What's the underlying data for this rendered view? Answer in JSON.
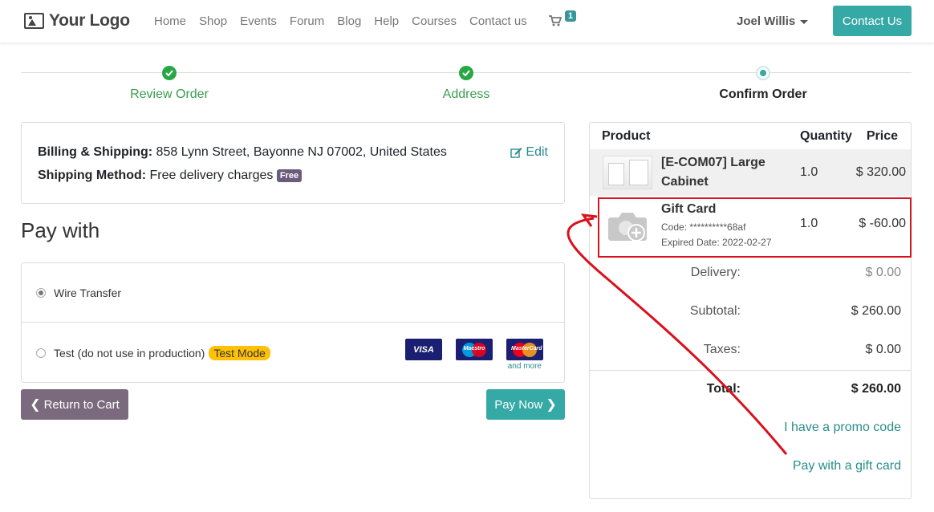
{
  "navbar": {
    "logo_text": "Your Logo",
    "links": [
      "Home",
      "Shop",
      "Events",
      "Forum",
      "Blog",
      "Help",
      "Courses",
      "Contact us"
    ],
    "cart_count": "1",
    "user_name": "Joel Willis",
    "contact_button": "Contact Us"
  },
  "steps": [
    {
      "label": "Review Order",
      "state": "done"
    },
    {
      "label": "Address",
      "state": "done"
    },
    {
      "label": "Confirm Order",
      "state": "current"
    }
  ],
  "billing": {
    "billing_label": "Billing & Shipping:",
    "billing_value": "858 Lynn Street, Bayonne NJ 07002, United States",
    "edit_label": "Edit",
    "shipping_label": "Shipping Method:",
    "shipping_value": "Free delivery charges",
    "free_badge": "Free"
  },
  "payment": {
    "heading": "Pay with",
    "options": [
      {
        "label": "Wire Transfer",
        "selected": true
      },
      {
        "label": "Test (do not use in production)",
        "selected": false,
        "badge": "Test Mode"
      }
    ],
    "card_logos": [
      "VISA",
      "Maestro",
      "MasterCard"
    ],
    "and_more": "and more",
    "return_button": "Return to Cart",
    "pay_button": "Pay Now"
  },
  "summary": {
    "headers": {
      "product": "Product",
      "quantity": "Quantity",
      "price": "Price"
    },
    "items": [
      {
        "name_line1": "[E-COM07] Large",
        "name_line2": "Cabinet",
        "quantity": "1.0",
        "price": "$ 320.00"
      },
      {
        "name": "Gift Card",
        "code": "Code: **********68af",
        "expired": "Expired Date: 2022-02-27",
        "quantity": "1.0",
        "price": "$ -60.00"
      }
    ],
    "delivery_label": "Delivery:",
    "delivery_value": "$ 0.00",
    "subtotal_label": "Subtotal:",
    "subtotal_value": "$ 260.00",
    "taxes_label": "Taxes:",
    "taxes_value": "$ 0.00",
    "total_label": "Total:",
    "total_value": "$ 260.00",
    "promo_link": "I have a promo code",
    "gift_link": "Pay with a gift card"
  },
  "colors": {
    "primary": "#35a9a5",
    "secondary": "#7b6a7d",
    "success": "#28a745",
    "link": "#2a8d8c",
    "annotation": "#d9121f"
  }
}
